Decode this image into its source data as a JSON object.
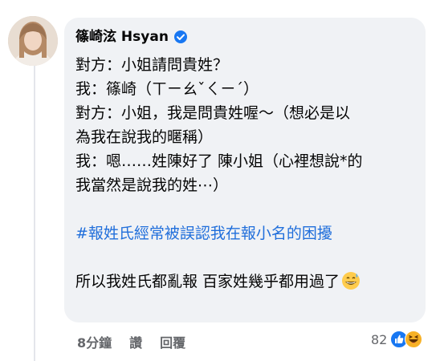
{
  "comment": {
    "author": "篠崎泫 Hsyan",
    "lines": [
      "對方：小姐請問貴姓？",
      "我：篠崎（ㄒㄧㄠˇㄑㄧˊ）",
      "對方：小姐，我是問貴姓喔～（想必是以",
      "為我在說我的暱稱）",
      "我：嗯……姓陳好了 陳小姐（心裡想說*的",
      "我當然是說我的姓⋯）"
    ],
    "hashtag": "#報姓氏經常被誤認我在報小名的困擾",
    "last_line": "所以我姓氏都亂報 百家姓幾乎都用過了",
    "emoji": "grinning-sweat-emoji"
  },
  "meta": {
    "time": "8分鐘",
    "like": "讚",
    "reply": "回覆"
  },
  "reactions": {
    "count": "82",
    "icons": [
      "like-reaction-icon",
      "haha-reaction-icon"
    ],
    "like_color": "#1877f2",
    "haha_color": "#f7b125"
  },
  "colors": {
    "bubble": "#f0f2f5",
    "hashtag": "#216fdb",
    "meta": "#65676b"
  }
}
